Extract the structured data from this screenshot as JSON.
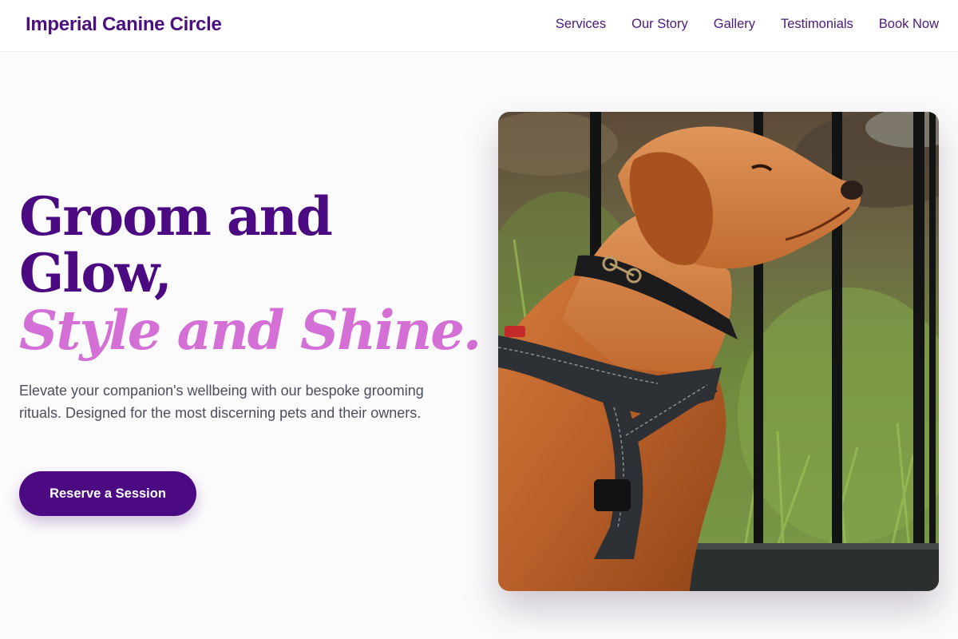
{
  "navbar": {
    "brand": "Imperial Canine Circle",
    "links": [
      "Services",
      "Our Story",
      "Gallery",
      "Testimonials",
      "Book Now"
    ]
  },
  "hero": {
    "headline_line1": "Groom and",
    "headline_line2": "Glow,",
    "headline_accent": "Style and Shine.",
    "subtext": "Elevate your companion's wellbeing with our bespoke grooming rituals. Designed for the most discerning pets and their owners.",
    "cta_label": "Reserve a Session"
  },
  "colors": {
    "brand_purple": "#4b0a82",
    "accent_pink": "#d46fd5",
    "body_text": "#4b4f5c",
    "background": "#fcfbfc"
  },
  "image": {
    "subject": "red labrador dog wearing black collar and harness, in profile against a black metal fence and tall grass"
  }
}
